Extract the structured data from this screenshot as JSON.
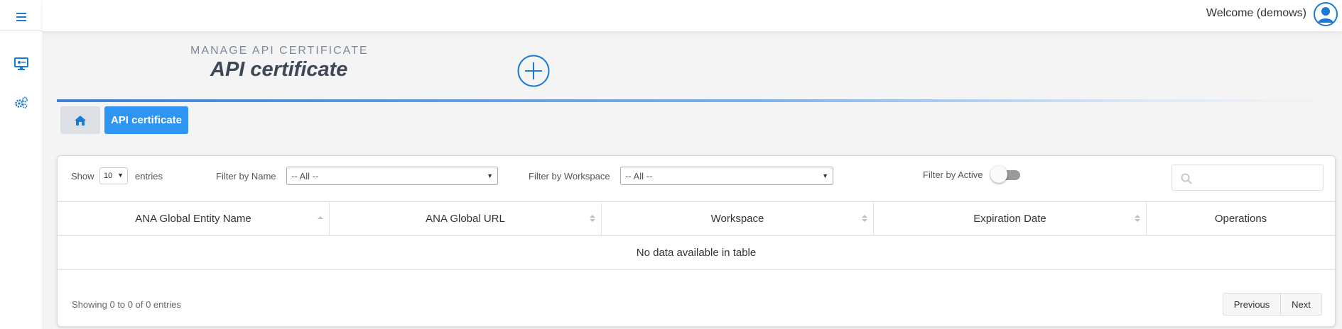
{
  "header": {
    "welcome_text": "Welcome (demows)",
    "subtitle": "MANAGE API CERTIFICATE",
    "title": "API certificate"
  },
  "breadcrumb": {
    "current": "API certificate"
  },
  "controls": {
    "show_label": "Show",
    "entries_value": "10",
    "entries_label": "entries",
    "filter_name_label": "Filter by Name",
    "filter_name_value": "-- All --",
    "filter_workspace_label": "Filter by Workspace",
    "filter_workspace_value": "-- All --",
    "filter_active_label": "Filter by Active",
    "filter_active_on": false
  },
  "table": {
    "columns": [
      {
        "label": "ANA Global Entity Name",
        "sort": "asc"
      },
      {
        "label": "ANA Global URL",
        "sort": "both"
      },
      {
        "label": "Workspace",
        "sort": "both"
      },
      {
        "label": "Expiration Date",
        "sort": "both"
      },
      {
        "label": "Operations",
        "sort": "none"
      }
    ],
    "empty_message": "No data available in table",
    "info": "Showing 0 to 0 of 0 entries"
  },
  "pagination": {
    "previous": "Previous",
    "next": "Next"
  },
  "colors": {
    "accent": "#2f95f5",
    "title": "#3d4756",
    "subtitle": "#7b8a9b",
    "icon": "#1a7bd6"
  }
}
